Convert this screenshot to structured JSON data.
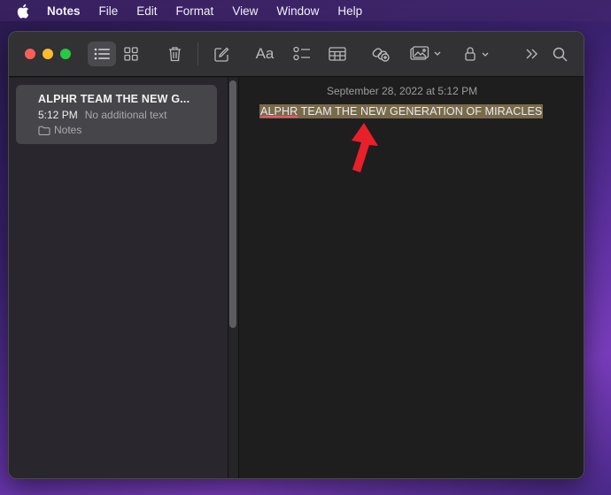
{
  "menubar": {
    "app_name": "Notes",
    "items": [
      "File",
      "Edit",
      "Format",
      "View",
      "Window",
      "Help"
    ]
  },
  "toolbar": {
    "icons": [
      "list-view-icon",
      "gallery-view-icon",
      "trash-icon",
      "compose-icon",
      "format-text-icon",
      "checklist-icon",
      "table-icon",
      "collaborate-icon",
      "media-icon",
      "lock-icon",
      "more-icon",
      "search-icon"
    ],
    "format_label": "Aa"
  },
  "sidebar": {
    "note": {
      "title": "ALPHR TEAM THE NEW G...",
      "time": "5:12 PM",
      "preview": "No additional text",
      "folder": "Notes"
    }
  },
  "editor": {
    "date": "September 28, 2022 at 5:12 PM",
    "body_word1": "ALPHR",
    "body_rest": " TEAM THE NEW GENERATION OF MIRACLES",
    "highlight_color": "#786a4b"
  },
  "annotation": {
    "arrow_color": "#e8202a"
  }
}
